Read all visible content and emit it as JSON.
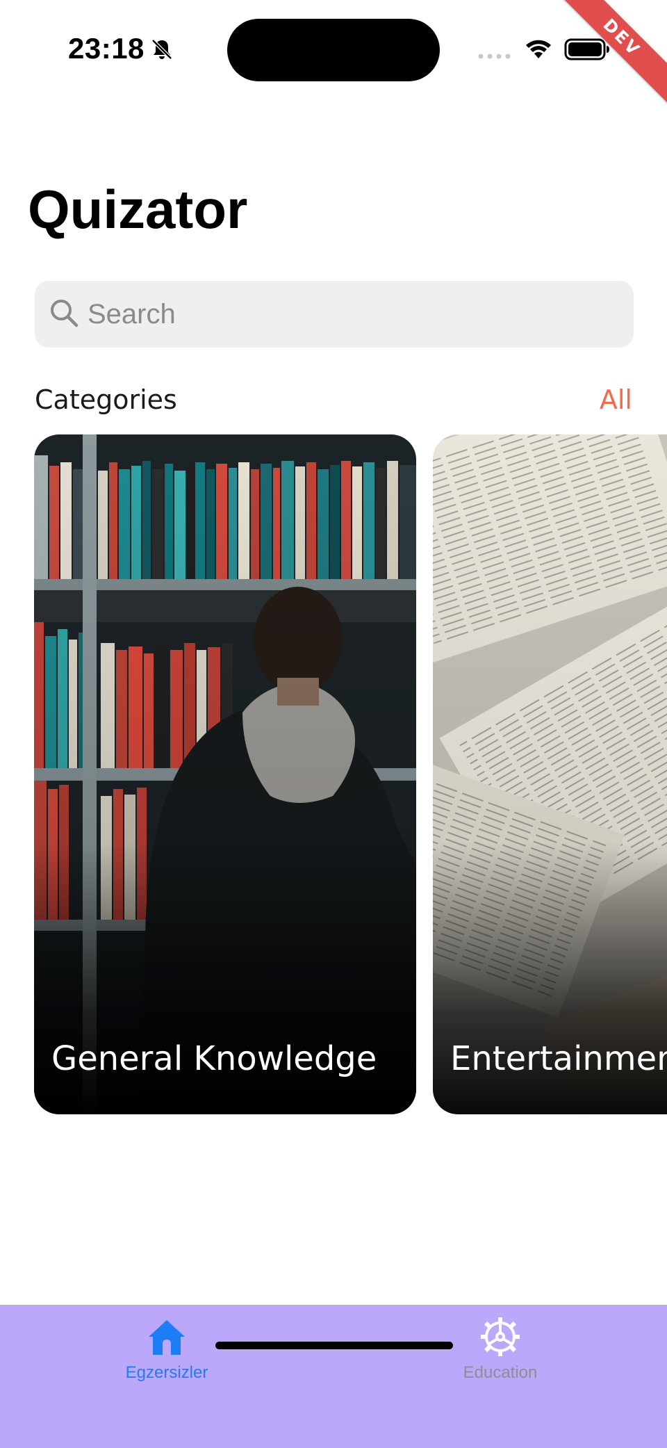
{
  "status_bar": {
    "time": "23:18",
    "bell_icon": "bell-slash-icon",
    "wifi_icon": "wifi-icon",
    "battery_icon": "battery-full-icon",
    "dev_banner": "DEV"
  },
  "app": {
    "title": "Quizator"
  },
  "search": {
    "placeholder": "Search",
    "value": "",
    "icon": "search-icon"
  },
  "categories": {
    "title": "Categories",
    "all_label": "All",
    "all_color": "#f2694f",
    "items": [
      {
        "label": "General Knowledge"
      },
      {
        "label": "Entertainment"
      }
    ]
  },
  "tab_bar": {
    "background": "#bca8fb",
    "items": [
      {
        "label": "Egzersizler",
        "icon": "home-icon",
        "active": true,
        "color": "#1e7cf5"
      },
      {
        "label": "Education",
        "icon": "gear-icon",
        "active": false,
        "color": "#8d8d93"
      }
    ]
  }
}
